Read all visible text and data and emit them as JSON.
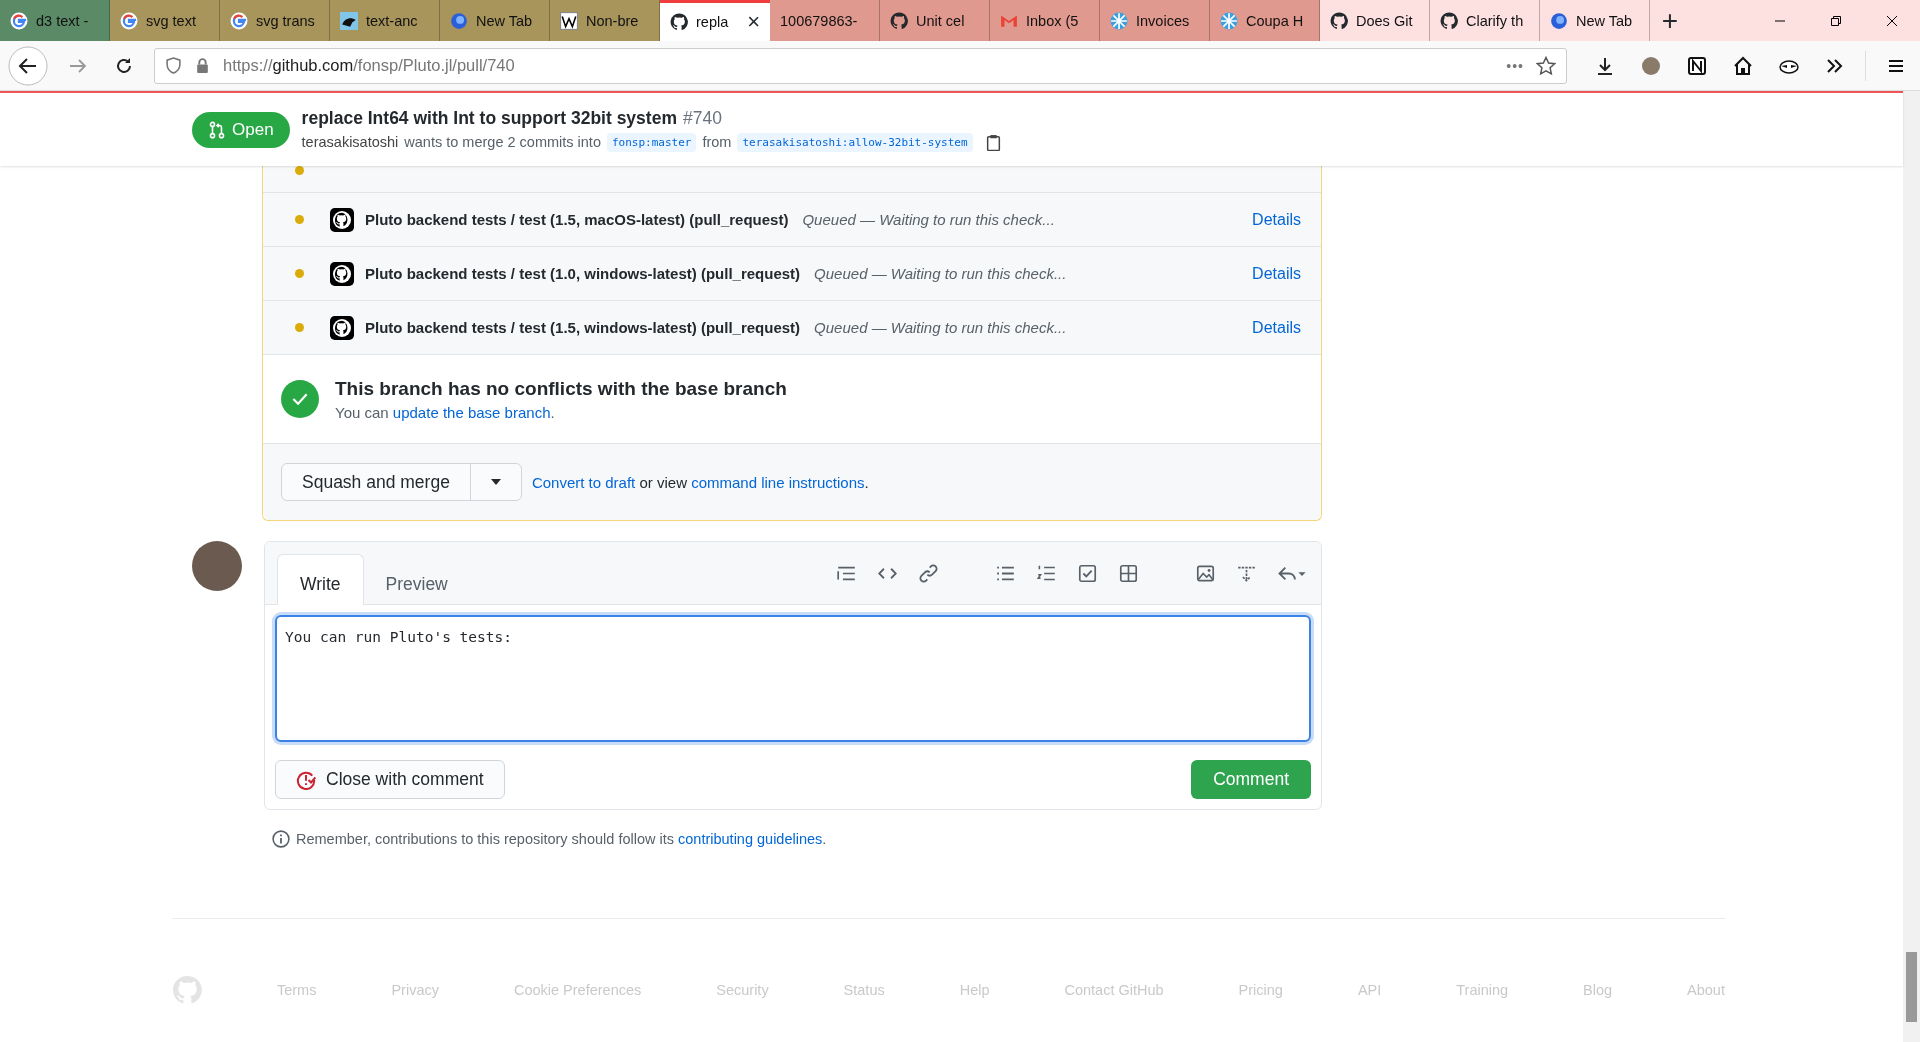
{
  "browser": {
    "tabs": [
      {
        "label": "d3 text -",
        "kind": "google",
        "color": "#5b8a67",
        "selected": false
      },
      {
        "label": "svg text",
        "kind": "google",
        "color": "#a8955c",
        "selected": false
      },
      {
        "label": "svg trans",
        "kind": "google",
        "color": "#a8955c",
        "selected": false
      },
      {
        "label": "text-anc",
        "kind": "panther",
        "color": "#a8955c",
        "selected": false
      },
      {
        "label": "New Tab",
        "kind": "firefox",
        "color": "#a8955c",
        "selected": false
      },
      {
        "label": "Non-bre",
        "kind": "wikipedia",
        "color": "#a8955c",
        "selected": false
      },
      {
        "label": "repla",
        "kind": "github",
        "color": "#ffffff",
        "selected": true
      },
      {
        "label": "100679863-",
        "kind": "plain",
        "color": "#e0998e",
        "selected": false
      },
      {
        "label": "Unit cel",
        "kind": "github",
        "color": "#e0998e",
        "selected": false
      },
      {
        "label": "Inbox (5",
        "kind": "gmail",
        "color": "#e0998e",
        "selected": false
      },
      {
        "label": "Invoices",
        "kind": "coupa",
        "color": "#e0998e",
        "selected": false
      },
      {
        "label": "Coupa H",
        "kind": "coupa",
        "color": "#e0998e",
        "selected": false
      },
      {
        "label": "Does Git",
        "kind": "github",
        "color": "#fde0e0",
        "selected": false
      },
      {
        "label": "Clarify th",
        "kind": "github",
        "color": "#fde0e0",
        "selected": false
      },
      {
        "label": "New Tab",
        "kind": "firefox",
        "color": "#fde0e0",
        "selected": false
      }
    ],
    "close_tab": "×",
    "new_tab": "+",
    "url": {
      "scheme": "https://",
      "host": "github.com",
      "path": "/fonsp/Pluto.jl/pull/740"
    },
    "page_actions": "•••"
  },
  "pr_header": {
    "state": "Open",
    "title": "replace Int64 with Int to support 32bit system",
    "number": "#740",
    "author": "terasakisatoshi",
    "summary": "wants to merge 2 commits into",
    "base": "fonsp:master",
    "from": "from",
    "head": "terasakisatoshi:allow-32bit-system"
  },
  "checks": [
    {
      "name": "Pluto backend tests / test (1.5, macOS-latest) (pull_request)",
      "status": "Queued — Waiting to run this check...",
      "link": "Details"
    },
    {
      "name": "Pluto backend tests / test (1.0, windows-latest) (pull_request)",
      "status": "Queued — Waiting to run this check...",
      "link": "Details"
    },
    {
      "name": "Pluto backend tests / test (1.5, windows-latest) (pull_request)",
      "status": "Queued — Waiting to run this check...",
      "link": "Details"
    }
  ],
  "branch_status": {
    "title": "This branch has no conflicts with the base branch",
    "text": "You can",
    "link": "update the base branch",
    "end": "."
  },
  "merge": {
    "button": "Squash and merge",
    "draft_link": "Convert to draft",
    "or_view": "or view",
    "instructions_link": "command line instructions",
    "end": "."
  },
  "comment": {
    "tabs": [
      {
        "label": "Write",
        "selected": true
      },
      {
        "label": "Preview",
        "selected": false
      }
    ],
    "value": "You can run Pluto's tests:",
    "close_button": "Close with comment",
    "submit_button": "Comment"
  },
  "reminder": {
    "text": "Remember, contributions to this repository should follow its",
    "link": "contributing guidelines",
    "end": "."
  },
  "footer": [
    "Terms",
    "Privacy",
    "Cookie Preferences",
    "Security",
    "Status",
    "Help",
    "Contact GitHub",
    "Pricing",
    "API",
    "Training",
    "Blog",
    "About"
  ]
}
